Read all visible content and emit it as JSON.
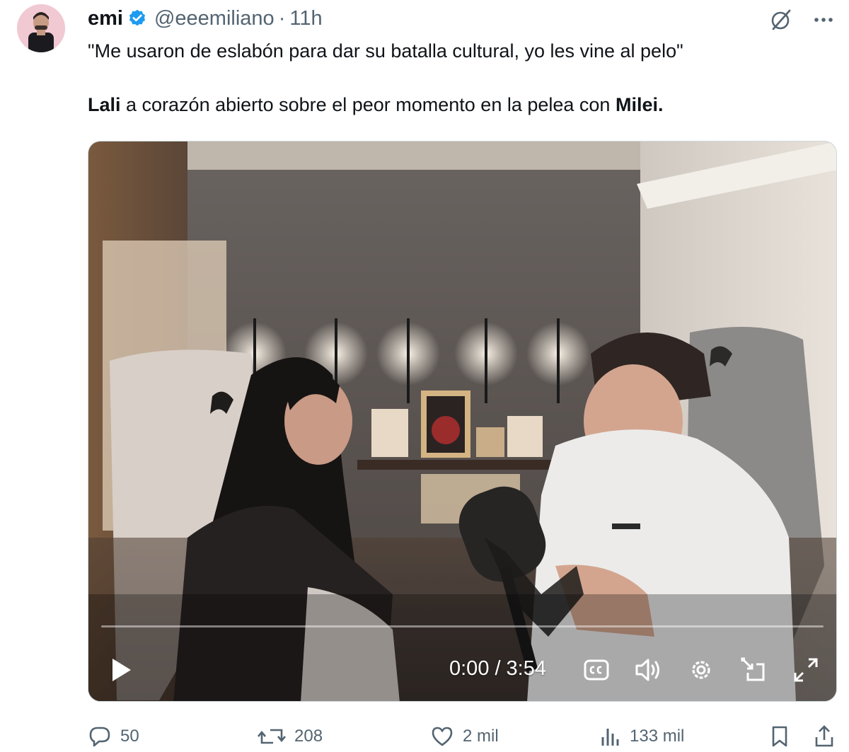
{
  "author": {
    "display_name": "emi",
    "handle": "@eeemiliano",
    "separator": "·",
    "time": "11h",
    "verified": true,
    "avatar_bg": "#f1c9d2",
    "verified_color": "#1d9bf0"
  },
  "header_icons": [
    "grok-slash-icon",
    "more-icon"
  ],
  "tweet": {
    "quote": "\"Me usaron de eslabón para dar su batalla cultural, yo les vine al pelo\"",
    "line2_bold1": "Lali",
    "line2_mid": " a corazón abierto sobre el peor momento en la pelea con ",
    "line2_bold2": "Milei",
    "line2_end": "."
  },
  "video": {
    "current_time": "0:00",
    "separator": "/",
    "duration": "3:54",
    "progress": 0,
    "controls": [
      "play-icon",
      "captions-icon",
      "volume-icon",
      "settings-icon",
      "pip-icon",
      "fullscreen-icon"
    ]
  },
  "actions": {
    "replies": "50",
    "reposts": "208",
    "likes": "2 mil",
    "views": "133 mil"
  },
  "colors": {
    "text": "#0f1419",
    "muted": "#536471",
    "accent": "#1d9bf0"
  }
}
